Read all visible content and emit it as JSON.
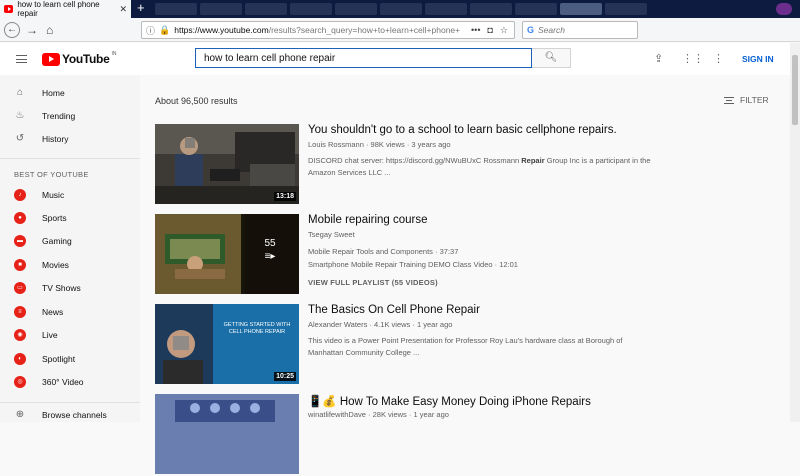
{
  "browser": {
    "active_tab_title": "how to learn cell phone repair",
    "url_domain": "https://www.youtube.com",
    "url_path": "/results?search_query=how+to+learn+cell+phone+",
    "search_placeholder": "Search"
  },
  "header": {
    "logo_text": "YouTube",
    "logo_region": "IN",
    "search_value": "how to learn cell phone repair",
    "signin_label": "SIGN IN"
  },
  "sidebar": {
    "primary": [
      {
        "label": "Home",
        "icon": "home-icon"
      },
      {
        "label": "Trending",
        "icon": "flame-icon"
      },
      {
        "label": "History",
        "icon": "history-icon"
      }
    ],
    "section_heading": "BEST OF YOUTUBE",
    "channels": [
      {
        "label": "Music",
        "icon": "music-icon"
      },
      {
        "label": "Sports",
        "icon": "sports-icon"
      },
      {
        "label": "Gaming",
        "icon": "gaming-icon"
      },
      {
        "label": "Movies",
        "icon": "movies-icon"
      },
      {
        "label": "TV Shows",
        "icon": "tv-icon"
      },
      {
        "label": "News",
        "icon": "news-icon"
      },
      {
        "label": "Live",
        "icon": "live-icon"
      },
      {
        "label": "Spotlight",
        "icon": "spotlight-icon"
      },
      {
        "label": "360° Video",
        "icon": "360-video-icon"
      }
    ],
    "browse_label": "Browse channels"
  },
  "results": {
    "count_text": "About 96,500 results",
    "filter_label": "FILTER",
    "items": [
      {
        "title": "You shouldn't go to a school to learn basic cellphone repairs.",
        "channel": "Louis Rossmann",
        "views": "98K views",
        "age": "3 years ago",
        "desc1_pre": "DISCORD chat server: https://discord.gg/NWuBUxC Rossmann ",
        "desc1_bold": "Repair",
        "desc1_post": " Group Inc is a participant in the",
        "desc2": "Amazon Services LLC ...",
        "duration": "13:18"
      },
      {
        "title": "Mobile repairing course",
        "channel": "Tsegay Sweet",
        "playlist_count": "55",
        "pl_line1": "Mobile Repair Tools and Components · 37:37",
        "pl_line2": "Smartphone Mobile Repair Training DEMO Class Video · 12:01",
        "pl_full": "VIEW FULL PLAYLIST (55 VIDEOS)"
      },
      {
        "title": "The Basics On Cell Phone Repair",
        "channel": "Alexander Waters",
        "views": "4.1K views",
        "age": "1 year ago",
        "desc1": "This video is a Power Point Presentation for Professor Roy Lau's hardware class at Borough of",
        "desc2": "Manhattan Community College ...",
        "duration": "10:25",
        "thumb_text": "GETTING STARTED WITH CELL PHONE REPAIR"
      },
      {
        "title": "📱💰 How To Make Easy Money Doing iPhone Repairs",
        "channel": "winatlifewithDave",
        "views": "28K views",
        "age": "1 year ago"
      }
    ]
  }
}
